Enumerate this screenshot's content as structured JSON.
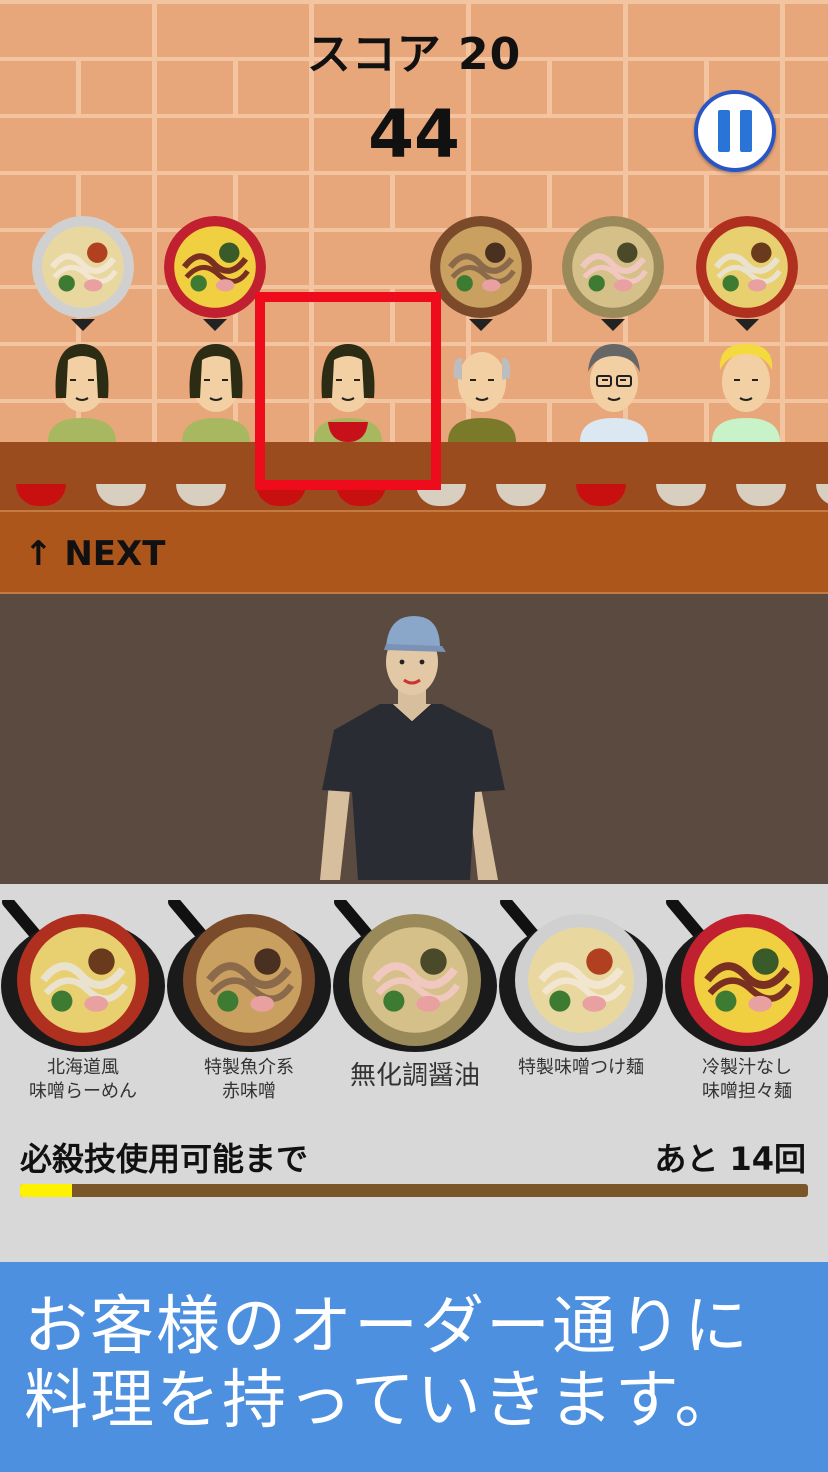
{
  "hud": {
    "score_label": "スコア 20",
    "timer": "44",
    "pause": "pause"
  },
  "queue": {
    "orders": [
      {
        "dish": "特製味噌つけ麺",
        "customer": "woman",
        "shirt": "#a8b860"
      },
      {
        "dish": "冷製汁なし味噌担々麺",
        "customer": "woman",
        "shirt": "#a8b860"
      },
      {
        "dish": "",
        "customer": "woman",
        "shirt": "#a8b860",
        "served": true
      },
      {
        "dish": "特製魚介系赤味噌",
        "customer": "old-man",
        "shirt": "#7a7a2a"
      },
      {
        "dish": "無化調醤油",
        "customer": "man-glasses",
        "shirt": "#dbe8f2"
      },
      {
        "dish": "北海道風味噌らーめん",
        "customer": "blond-man",
        "shirt": "#c8f2c8"
      }
    ],
    "counter_bowls": [
      "red",
      "white",
      "white",
      "red",
      "red",
      "white",
      "white",
      "red",
      "white",
      "white",
      "white"
    ],
    "next_label": "↑ NEXT"
  },
  "pans": [
    {
      "name": "北海道風\n味噌らーめん"
    },
    {
      "name": "特製魚介系\n赤味噌"
    },
    {
      "name": "無化調醤油",
      "large": true
    },
    {
      "name": "特製味噌つけ麺"
    },
    {
      "name": "冷製汁なし\n味噌担々麺"
    }
  ],
  "special": {
    "label": "必殺技使用可能まで",
    "remaining": "あと 14回",
    "progress": 0.066
  },
  "banner": {
    "line1": "お客様のオーダー通りに",
    "line2": "料理を持っていきます。"
  },
  "colors": {
    "highlight": "#ee0c1c",
    "banner": "#4e90e0",
    "gauge": "#fff200"
  }
}
